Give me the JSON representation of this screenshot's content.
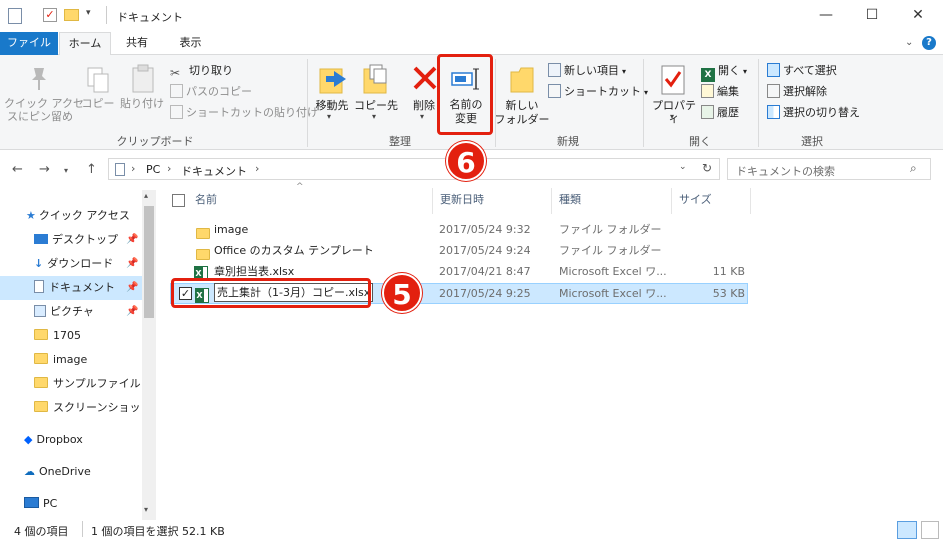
{
  "window": {
    "title": "ドキュメント",
    "min": "—",
    "max": "☐",
    "close": "✕"
  },
  "tabs": [
    {
      "label": "ファイル"
    },
    {
      "label": "ホーム"
    },
    {
      "label": "共有"
    },
    {
      "label": "表示"
    }
  ],
  "ribbon": {
    "clipboard": {
      "group_label": "クリップボード",
      "pin": "クイック アクセ\nスにピン留め",
      "copy": "コピー",
      "paste": "貼り付け",
      "cut": "切り取り",
      "copy_path": "パスのコピー",
      "paste_shortcut": "ショートカットの貼り付け"
    },
    "organize": {
      "group_label": "整理",
      "move_to": "移動先",
      "copy_to": "コピー先",
      "delete": "削除",
      "rename_line1": "名前の",
      "rename_line2": "変更"
    },
    "new": {
      "group_label": "新規",
      "new_folder_line1": "新しい",
      "new_folder_line2": "フォルダー",
      "new_item": "新しい項目",
      "easy_access": "ショートカット"
    },
    "open": {
      "group_label": "開く",
      "properties": "プロパティ",
      "open": "開く",
      "edit": "編集",
      "history": "履歴"
    },
    "select": {
      "group_label": "選択",
      "select_all": "すべて選択",
      "select_none": "選択解除",
      "invert": "選択の切り替え"
    }
  },
  "address": {
    "pc": "PC",
    "folder": "ドキュメント",
    "search_placeholder": "ドキュメントの検索"
  },
  "nav": [
    {
      "label": "クイック アクセス"
    },
    {
      "label": "デスクトップ"
    },
    {
      "label": "ダウンロード"
    },
    {
      "label": "ドキュメント"
    },
    {
      "label": "ピクチャ"
    },
    {
      "label": "1705"
    },
    {
      "label": "image"
    },
    {
      "label": "サンプルファイル"
    },
    {
      "label": "スクリーンショット"
    },
    {
      "label": "Dropbox"
    },
    {
      "label": "OneDrive"
    },
    {
      "label": "PC"
    }
  ],
  "columns": {
    "name": "名前",
    "date": "更新日時",
    "type": "種類",
    "size": "サイズ"
  },
  "files": [
    {
      "name": "image",
      "date": "2017/05/24 9:32",
      "type": "ファイル フォルダー",
      "size": ""
    },
    {
      "name": "Office のカスタム テンプレート",
      "date": "2017/05/24 9:24",
      "type": "ファイル フォルダー",
      "size": ""
    },
    {
      "name": "章別担当表.xlsx",
      "date": "2017/04/21 8:47",
      "type": "Microsoft Excel ワ...",
      "size": "11 KB"
    },
    {
      "name": "売上集計（1-3月）コピー.xlsx",
      "date": "2017/05/24 9:25",
      "type": "Microsoft Excel ワ...",
      "size": "53 KB"
    }
  ],
  "status": {
    "count": "4 個の項目",
    "selected": "1 個の項目を選択 52.1 KB"
  },
  "callouts": {
    "step5": "5",
    "step6": "6"
  },
  "colors": {
    "file_tab": "#1979ca",
    "selection": "#cce8ff",
    "callout": "#e3200f"
  }
}
